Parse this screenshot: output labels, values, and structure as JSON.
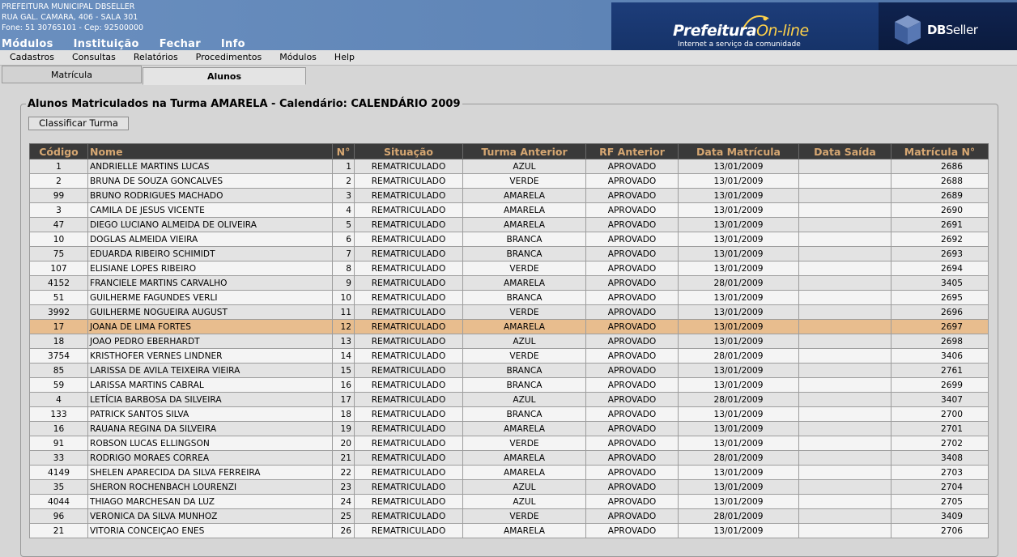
{
  "header": {
    "org_lines": [
      "PREFEITURA MUNICIPAL DBSELLER",
      "RUA GAL. CAMARA, 406 - SALA 301",
      "Fone: 51 30765101  -  Cep: 92500000"
    ],
    "nav": [
      "Módulos",
      "Instituição",
      "Fechar",
      "Info"
    ],
    "brand_main": "Prefeitura",
    "brand_accent": "On-line",
    "brand_tagline": "Internet a serviço da comunidade",
    "dbseller_bold": "DB",
    "dbseller_light": "Seller"
  },
  "menubar": [
    "Cadastros",
    "Consultas",
    "Relatórios",
    "Procedimentos",
    "Módulos",
    "Help"
  ],
  "tabs": [
    "Matrícula",
    "Alunos"
  ],
  "main": {
    "legend": "Alunos Matriculados na Turma AMARELA - Calendário: CALENDÁRIO 2009",
    "classify_button": "Classificar Turma"
  },
  "table": {
    "columns": [
      "Código",
      "Nome",
      "N°",
      "Situação",
      "Turma Anterior",
      "RF Anterior",
      "Data Matrícula",
      "Data Saída",
      "Matrícula N°"
    ],
    "selected_index": 11,
    "rows": [
      [
        "1",
        "ANDRIELLE MARTINS LUCAS",
        "1",
        "REMATRICULADO",
        "AZUL",
        "APROVADO",
        "13/01/2009",
        "",
        "2686"
      ],
      [
        "2",
        "BRUNA DE SOUZA GONCALVES",
        "2",
        "REMATRICULADO",
        "VERDE",
        "APROVADO",
        "13/01/2009",
        "",
        "2688"
      ],
      [
        "99",
        "BRUNO RODRIGUES MACHADO",
        "3",
        "REMATRICULADO",
        "AMARELA",
        "APROVADO",
        "13/01/2009",
        "",
        "2689"
      ],
      [
        "3",
        "CAMILA DE JESUS VICENTE",
        "4",
        "REMATRICULADO",
        "AMARELA",
        "APROVADO",
        "13/01/2009",
        "",
        "2690"
      ],
      [
        "47",
        "DIEGO LUCIANO ALMEIDA DE OLIVEIRA",
        "5",
        "REMATRICULADO",
        "AMARELA",
        "APROVADO",
        "13/01/2009",
        "",
        "2691"
      ],
      [
        "10",
        "DOGLAS ALMEIDA VIEIRA",
        "6",
        "REMATRICULADO",
        "BRANCA",
        "APROVADO",
        "13/01/2009",
        "",
        "2692"
      ],
      [
        "75",
        "EDUARDA RIBEIRO SCHIMIDT",
        "7",
        "REMATRICULADO",
        "BRANCA",
        "APROVADO",
        "13/01/2009",
        "",
        "2693"
      ],
      [
        "107",
        "ELISIANE LOPES RIBEIRO",
        "8",
        "REMATRICULADO",
        "VERDE",
        "APROVADO",
        "13/01/2009",
        "",
        "2694"
      ],
      [
        "4152",
        "FRANCIELE MARTINS CARVALHO",
        "9",
        "REMATRICULADO",
        "AMARELA",
        "APROVADO",
        "28/01/2009",
        "",
        "3405"
      ],
      [
        "51",
        "GUILHERME FAGUNDES VERLI",
        "10",
        "REMATRICULADO",
        "BRANCA",
        "APROVADO",
        "13/01/2009",
        "",
        "2695"
      ],
      [
        "3992",
        "GUILHERME NOGUEIRA AUGUST",
        "11",
        "REMATRICULADO",
        "VERDE",
        "APROVADO",
        "13/01/2009",
        "",
        "2696"
      ],
      [
        "17",
        "JOANA DE LIMA FORTES",
        "12",
        "REMATRICULADO",
        "AMARELA",
        "APROVADO",
        "13/01/2009",
        "",
        "2697"
      ],
      [
        "18",
        "JOAO PEDRO EBERHARDT",
        "13",
        "REMATRICULADO",
        "AZUL",
        "APROVADO",
        "13/01/2009",
        "",
        "2698"
      ],
      [
        "3754",
        "KRISTHOFER VERNES LINDNER",
        "14",
        "REMATRICULADO",
        "VERDE",
        "APROVADO",
        "28/01/2009",
        "",
        "3406"
      ],
      [
        "85",
        "LARISSA DE AVILA TEIXEIRA VIEIRA",
        "15",
        "REMATRICULADO",
        "BRANCA",
        "APROVADO",
        "13/01/2009",
        "",
        "2761"
      ],
      [
        "59",
        "LARISSA MARTINS CABRAL",
        "16",
        "REMATRICULADO",
        "BRANCA",
        "APROVADO",
        "13/01/2009",
        "",
        "2699"
      ],
      [
        "4",
        "LETÍCIA BARBOSA DA SILVEIRA",
        "17",
        "REMATRICULADO",
        "AZUL",
        "APROVADO",
        "28/01/2009",
        "",
        "3407"
      ],
      [
        "133",
        "PATRICK SANTOS SILVA",
        "18",
        "REMATRICULADO",
        "BRANCA",
        "APROVADO",
        "13/01/2009",
        "",
        "2700"
      ],
      [
        "16",
        "RAUANA REGINA DA SILVEIRA",
        "19",
        "REMATRICULADO",
        "AMARELA",
        "APROVADO",
        "13/01/2009",
        "",
        "2701"
      ],
      [
        "91",
        "ROBSON LUCAS ELLINGSON",
        "20",
        "REMATRICULADO",
        "VERDE",
        "APROVADO",
        "13/01/2009",
        "",
        "2702"
      ],
      [
        "33",
        "RODRIGO MORAES CORREA",
        "21",
        "REMATRICULADO",
        "AMARELA",
        "APROVADO",
        "28/01/2009",
        "",
        "3408"
      ],
      [
        "4149",
        "SHELEN APARECIDA DA SILVA FERREIRA",
        "22",
        "REMATRICULADO",
        "AMARELA",
        "APROVADO",
        "13/01/2009",
        "",
        "2703"
      ],
      [
        "35",
        "SHERON ROCHENBACH LOURENZI",
        "23",
        "REMATRICULADO",
        "AZUL",
        "APROVADO",
        "13/01/2009",
        "",
        "2704"
      ],
      [
        "4044",
        "THIAGO MARCHESAN DA LUZ",
        "24",
        "REMATRICULADO",
        "AZUL",
        "APROVADO",
        "13/01/2009",
        "",
        "2705"
      ],
      [
        "96",
        "VERONICA DA SILVA MUNHOZ",
        "25",
        "REMATRICULADO",
        "VERDE",
        "APROVADO",
        "28/01/2009",
        "",
        "3409"
      ],
      [
        "21",
        "VITORIA CONCEIÇAO ENES",
        "26",
        "REMATRICULADO",
        "AMARELA",
        "APROVADO",
        "13/01/2009",
        "",
        "2706"
      ]
    ]
  },
  "colors": {
    "header_bg": "#5e84b6",
    "table_header_bg": "#3a3a3a",
    "table_header_text": "#d6a772",
    "selected_row": "#e8bd8e",
    "brand_accent": "#ffd24a"
  }
}
